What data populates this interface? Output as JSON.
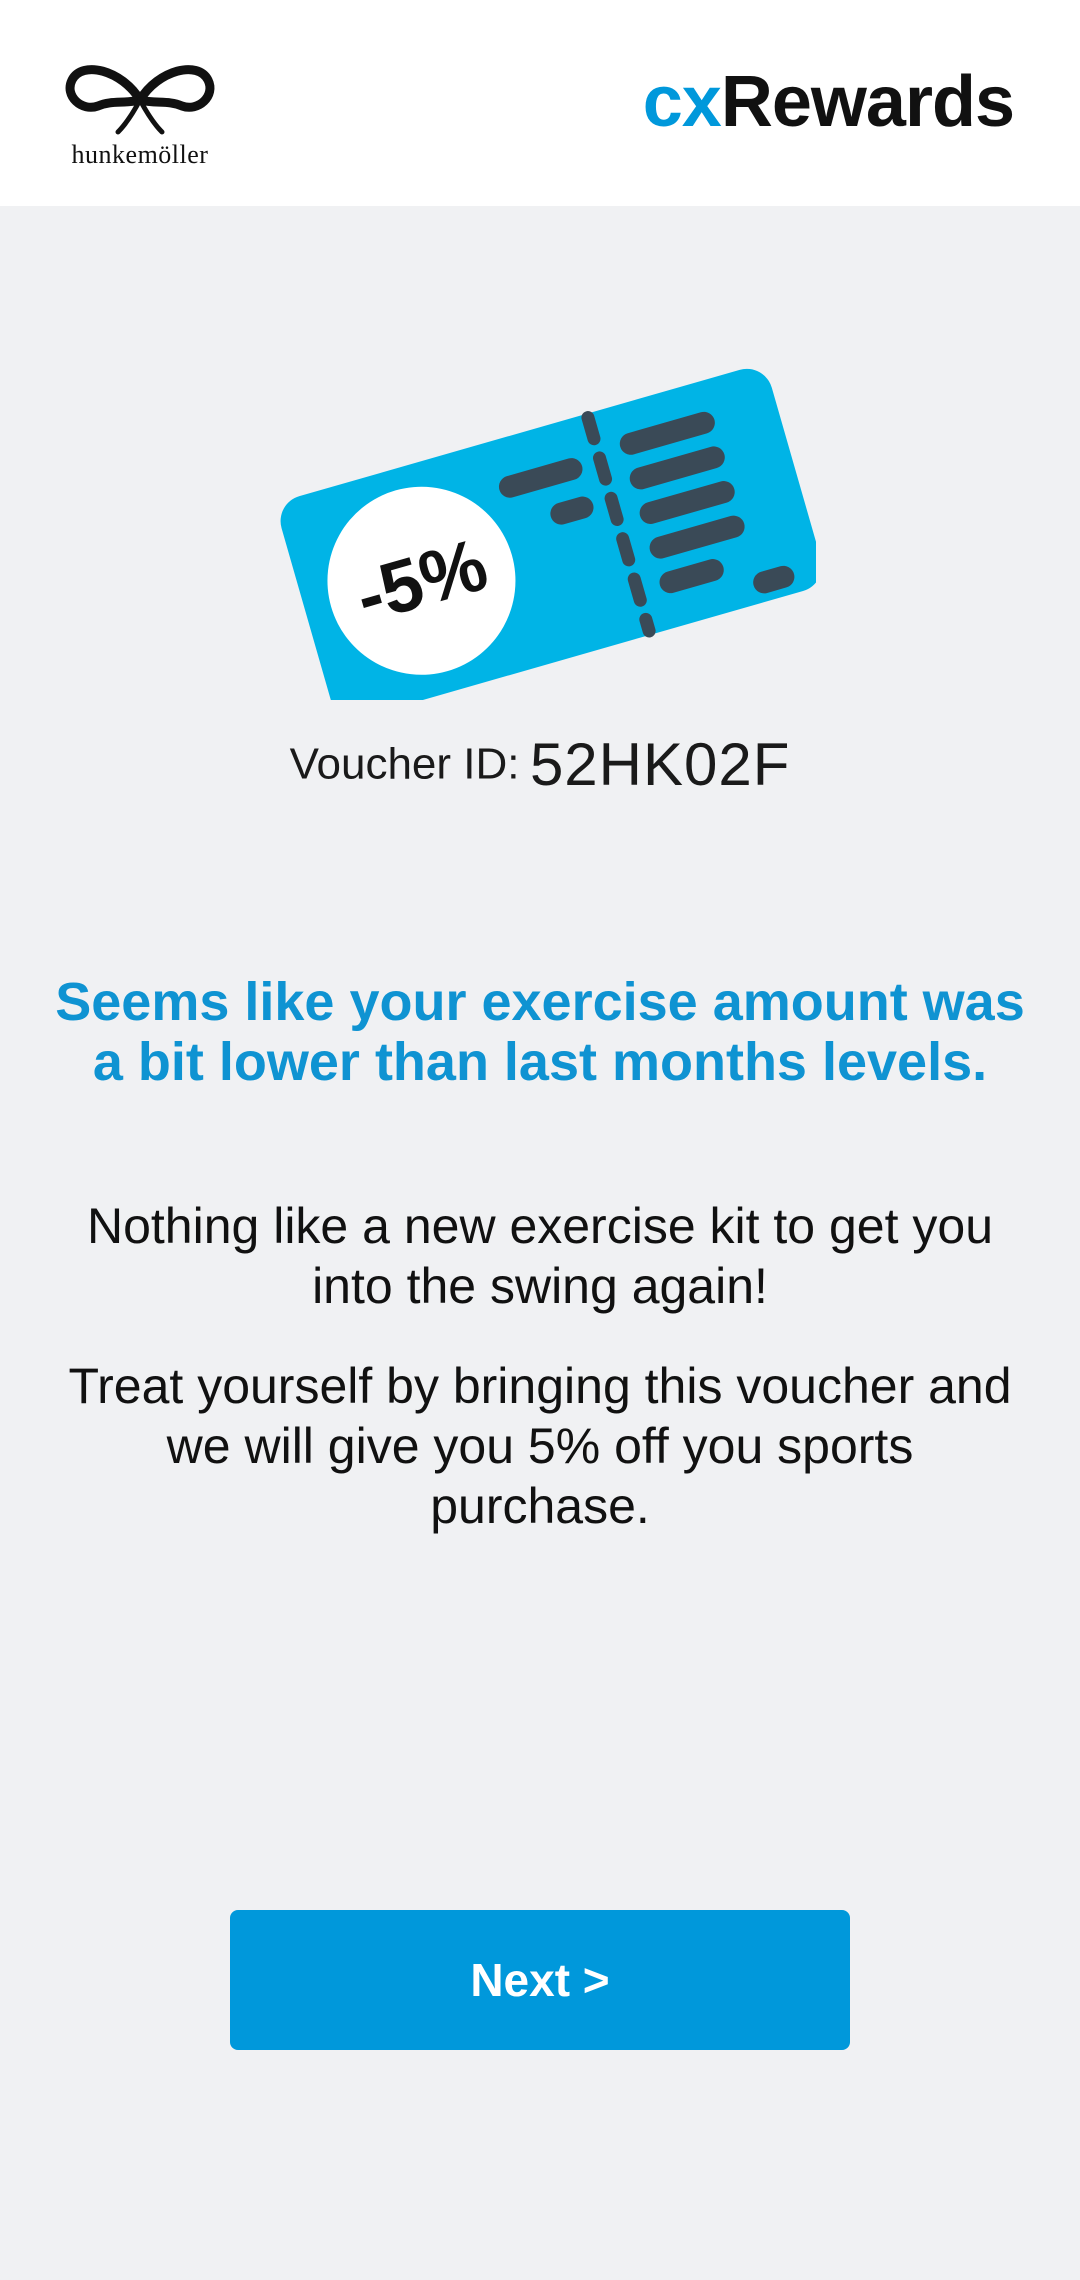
{
  "header": {
    "logo_text": "hunkemöller",
    "brand_prefix": "cx",
    "brand_suffix": "Rewards"
  },
  "voucher": {
    "discount_label": "-5%",
    "id_label": "Voucher ID:",
    "id_value": "52HK02F",
    "colors": {
      "ticket": "#00b4e6",
      "detail": "#3a4a57"
    }
  },
  "message": {
    "headline": "Seems like your exercise amount was a bit lower than last months levels.",
    "paragraph1": "Nothing like a new exercise kit to get you into the swing again!",
    "paragraph2": "Treat yourself by bringing this voucher and we will give you 5% off you sports purchase."
  },
  "actions": {
    "next_label": "Next >"
  },
  "colors": {
    "accent": "#0098db",
    "background": "#f0f1f3"
  }
}
